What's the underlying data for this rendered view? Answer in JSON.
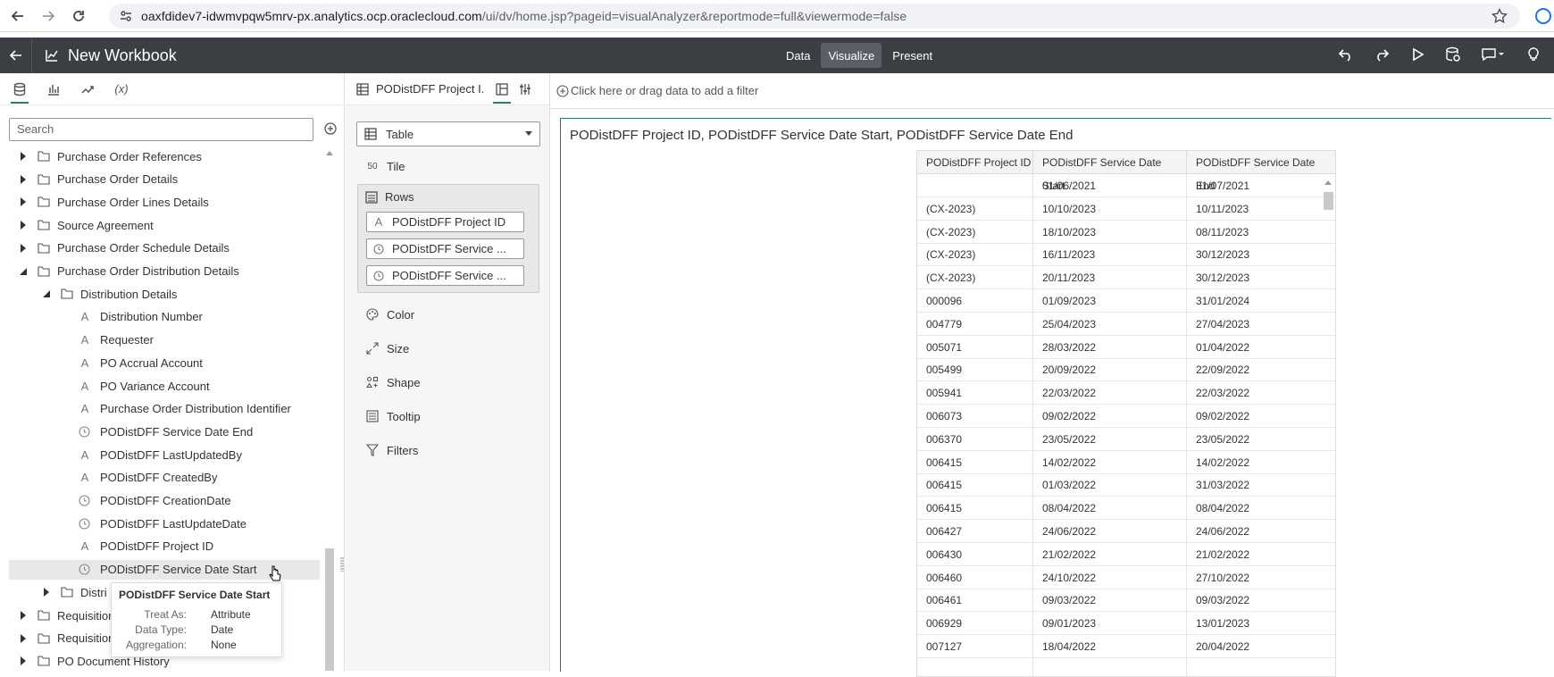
{
  "browser": {
    "url_host": "oaxfdidev7-idwmvpqw5mrv-px.analytics.ocp.oraclecloud.com",
    "url_path": "/ui/dv/home.jsp?pageid=visualAnalyzer&reportmode=full&viewermode=false"
  },
  "app": {
    "title": "New Workbook",
    "tabs": [
      {
        "label": "Data"
      },
      {
        "label": "Visualize"
      },
      {
        "label": "Present"
      }
    ]
  },
  "data_panel": {
    "search_placeholder": "Search",
    "tab_expression_label": "(x)",
    "tree": [
      {
        "label": "Purchase Order References",
        "type": "folder",
        "depth": 0,
        "expanded": false
      },
      {
        "label": "Purchase Order Details",
        "type": "folder",
        "depth": 0,
        "expanded": false
      },
      {
        "label": "Purchase Order Lines Details",
        "type": "folder",
        "depth": 0,
        "expanded": false
      },
      {
        "label": "Source Agreement",
        "type": "folder",
        "depth": 0,
        "expanded": false
      },
      {
        "label": "Purchase Order Schedule Details",
        "type": "folder",
        "depth": 0,
        "expanded": false
      },
      {
        "label": "Purchase Order Distribution Details",
        "type": "folder",
        "depth": 0,
        "expanded": true
      },
      {
        "label": "Distribution Details",
        "type": "folder",
        "depth": 1,
        "expanded": true
      },
      {
        "label": "Distribution Number",
        "type": "attribute",
        "depth": 2
      },
      {
        "label": "Requester",
        "type": "attribute",
        "depth": 2
      },
      {
        "label": "PO Accrual Account",
        "type": "attribute",
        "depth": 2
      },
      {
        "label": "PO Variance Account",
        "type": "attribute",
        "depth": 2
      },
      {
        "label": "Purchase Order Distribution Identifier",
        "type": "attribute",
        "depth": 2
      },
      {
        "label": "PODistDFF Service Date End",
        "type": "date",
        "depth": 2
      },
      {
        "label": "PODistDFF LastUpdatedBy",
        "type": "attribute",
        "depth": 2
      },
      {
        "label": "PODistDFF CreatedBy",
        "type": "attribute",
        "depth": 2
      },
      {
        "label": "PODistDFF CreationDate",
        "type": "date",
        "depth": 2
      },
      {
        "label": "PODistDFF LastUpdateDate",
        "type": "date",
        "depth": 2
      },
      {
        "label": "PODistDFF Project ID",
        "type": "attribute",
        "depth": 2
      },
      {
        "label": "PODistDFF Service Date Start",
        "type": "date",
        "depth": 2,
        "selected": true
      },
      {
        "label": "Distri",
        "type": "folder",
        "depth": 1,
        "expanded": false
      },
      {
        "label": "Requisition",
        "type": "folder",
        "depth": 0,
        "expanded": false
      },
      {
        "label": "Requisition",
        "type": "folder",
        "depth": 0,
        "expanded": false
      },
      {
        "label": "PO Document History",
        "type": "folder",
        "depth": 0,
        "expanded": false
      }
    ],
    "tooltip": {
      "title": "PODistDFF Service Date Start",
      "rows": [
        {
          "k": "Treat As:",
          "v": "Attribute"
        },
        {
          "k": "Data Type:",
          "v": "Date"
        },
        {
          "k": "Aggregation:",
          "v": "None"
        }
      ]
    }
  },
  "grammar": {
    "header_name": "PODistDFF Project I...",
    "viz_type": "Table",
    "tile": "Tile",
    "rows_label": "Rows",
    "row_pills": [
      {
        "label": "PODistDFF Project ID",
        "kind": "attribute"
      },
      {
        "label": "PODistDFF Service ...",
        "kind": "date"
      },
      {
        "label": "PODistDFF Service ...",
        "kind": "date"
      }
    ],
    "items": [
      {
        "label": "Color",
        "icon": "palette-icon"
      },
      {
        "label": "Size",
        "icon": "size-icon"
      },
      {
        "label": "Shape",
        "icon": "shape-icon"
      },
      {
        "label": "Tooltip",
        "icon": "tooltip-icon"
      },
      {
        "label": "Filters",
        "icon": "filter-icon"
      }
    ]
  },
  "canvas": {
    "filter_hint": "Click here or drag data to add a filter",
    "viz_title": "PODistDFF Project ID, PODistDFF Service Date Start, PODistDFF Service Date End",
    "table": {
      "columns": [
        "PODistDFF Project ID",
        "PODistDFF Service Date Start",
        "PODistDFF Service Date End"
      ],
      "rows": [
        [
          "",
          "01/06/2021",
          "31/07/2021"
        ],
        [
          "(CX-2023)",
          "10/10/2023",
          "10/11/2023"
        ],
        [
          "(CX-2023)",
          "18/10/2023",
          "08/11/2023"
        ],
        [
          "(CX-2023)",
          "16/11/2023",
          "30/12/2023"
        ],
        [
          "(CX-2023)",
          "20/11/2023",
          "30/12/2023"
        ],
        [
          "000096",
          "01/09/2023",
          "31/01/2024"
        ],
        [
          "004779",
          "25/04/2023",
          "27/04/2023"
        ],
        [
          "005071",
          "28/03/2022",
          "01/04/2022"
        ],
        [
          "005499",
          "20/09/2022",
          "22/09/2022"
        ],
        [
          "005941",
          "22/03/2022",
          "22/03/2022"
        ],
        [
          "006073",
          "09/02/2022",
          "09/02/2022"
        ],
        [
          "006370",
          "23/05/2022",
          "23/05/2022"
        ],
        [
          "006415",
          "14/02/2022",
          "14/02/2022"
        ],
        [
          "006415",
          "01/03/2022",
          "31/03/2022"
        ],
        [
          "006415",
          "08/04/2022",
          "08/04/2022"
        ],
        [
          "006427",
          "24/06/2022",
          "24/06/2022"
        ],
        [
          "006430",
          "21/02/2022",
          "21/02/2022"
        ],
        [
          "006460",
          "24/10/2022",
          "27/10/2022"
        ],
        [
          "006461",
          "09/03/2022",
          "09/03/2022"
        ],
        [
          "006929",
          "09/01/2023",
          "13/01/2023"
        ],
        [
          "007127",
          "18/04/2022",
          "20/04/2022"
        ],
        [
          "",
          "",
          ""
        ]
      ]
    }
  }
}
